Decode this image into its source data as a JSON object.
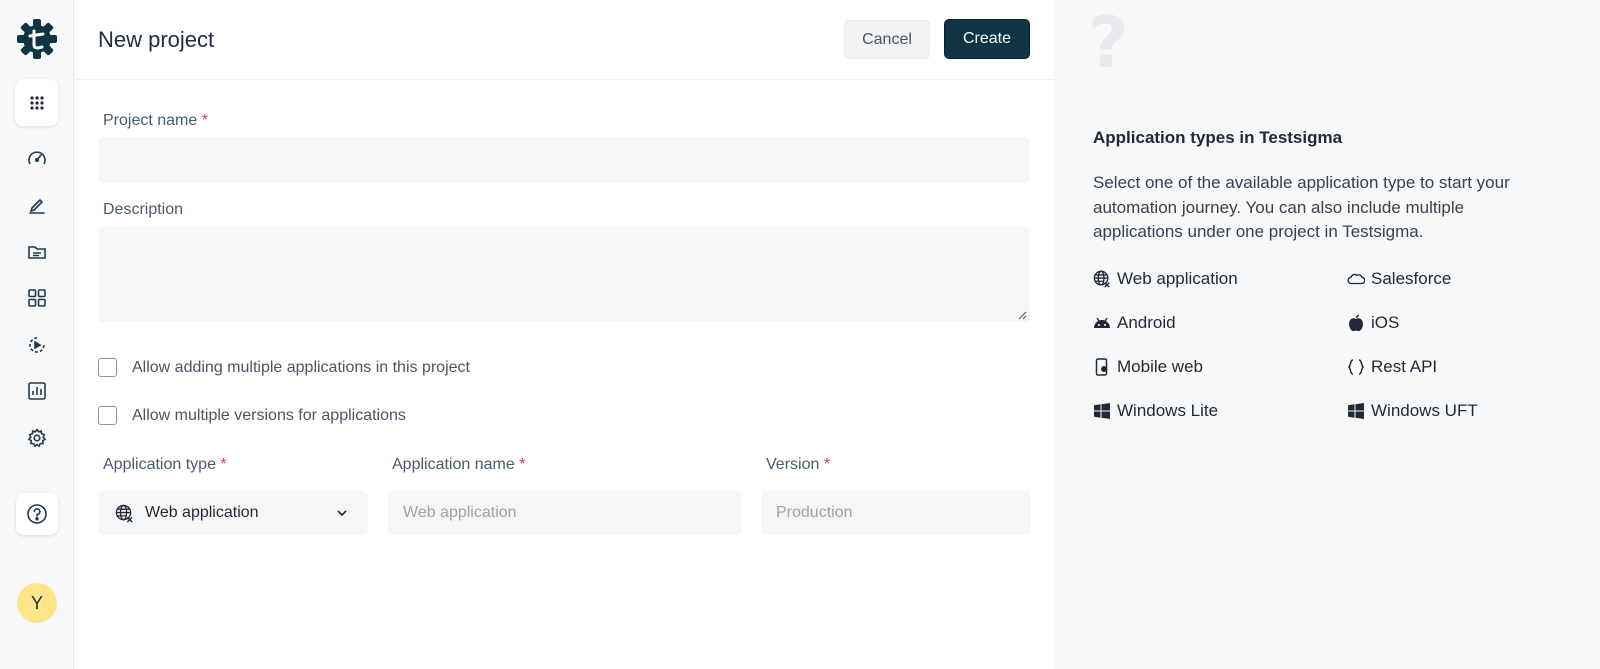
{
  "sidebar": {
    "avatar_initial": "Y"
  },
  "header": {
    "title": "New project",
    "cancel_label": "Cancel",
    "create_label": "Create"
  },
  "form": {
    "project_name_label": "Project name",
    "project_name_value": "",
    "description_label": "Description",
    "description_value": "",
    "required_mark": "*",
    "allow_multiple_apps_label": "Allow adding multiple applications in this project",
    "allow_multiple_apps_checked": false,
    "allow_multiple_versions_label": "Allow multiple versions for applications",
    "allow_multiple_versions_checked": false,
    "application_type_label": "Application type",
    "application_type_value": "Web application",
    "application_name_label": "Application name",
    "application_name_placeholder": "Web application",
    "version_label": "Version",
    "version_placeholder": "Production"
  },
  "panel": {
    "title": "Application types in Testsigma",
    "description": "Select one of the available application type to start your automation journey. You can also include multiple applications under one project in Testsigma.",
    "app_types": [
      {
        "label": "Web application",
        "icon": "globe-icon"
      },
      {
        "label": "Salesforce",
        "icon": "cloud-icon"
      },
      {
        "label": "Android",
        "icon": "android-icon"
      },
      {
        "label": "iOS",
        "icon": "apple-icon"
      },
      {
        "label": "Mobile web",
        "icon": "mobile-icon"
      },
      {
        "label": "Rest API",
        "icon": "braces-icon"
      },
      {
        "label": "Windows Lite",
        "icon": "windows-icon"
      },
      {
        "label": "Windows UFT",
        "icon": "windows-icon"
      }
    ]
  },
  "colors": {
    "primary": "#0f3443",
    "required": "#d64545",
    "avatar_bg": "#fde68a"
  }
}
